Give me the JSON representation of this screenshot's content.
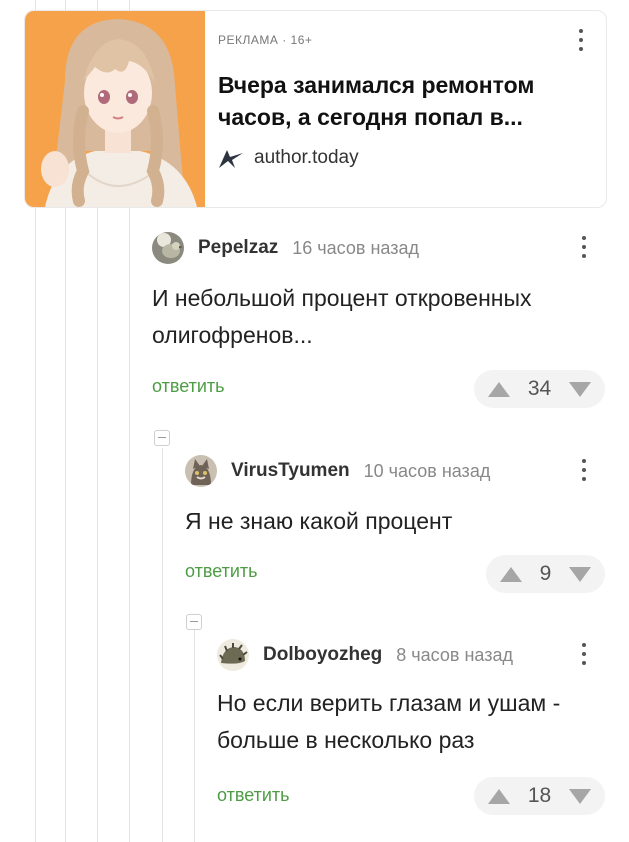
{
  "ad": {
    "label": "РЕКЛАМА · 16+",
    "title": "Вчера занимался ремонтом часов, а сегодня попал в...",
    "source": "author.today",
    "source_icon": "author-today-logo-icon",
    "image": "anime-girl-illustration",
    "image_bg": "#f6a24b"
  },
  "comments": [
    {
      "author": "Pepelzaz",
      "time": "16 часов назад",
      "text": "И небольшой процент откровенных олигофренов...",
      "reply_label": "ответить",
      "rating": "34",
      "avatar": "bird-photo-avatar"
    },
    {
      "author": "VirusTyumen",
      "time": "10 часов назад",
      "text": "Я не знаю какой процент",
      "reply_label": "ответить",
      "rating": "9",
      "avatar": "cat-photo-avatar"
    },
    {
      "author": "Dolboyozheg",
      "time": "8 часов назад",
      "text": "Но если верить глазам и ушам - больше в несколько раз",
      "reply_label": "ответить",
      "rating": "18",
      "avatar": "hedgehog-photo-avatar"
    }
  ],
  "colors": {
    "reply_green": "#4d9c44",
    "rating_bg": "#f3f3f3",
    "thread_line": "#e3e3e3"
  }
}
